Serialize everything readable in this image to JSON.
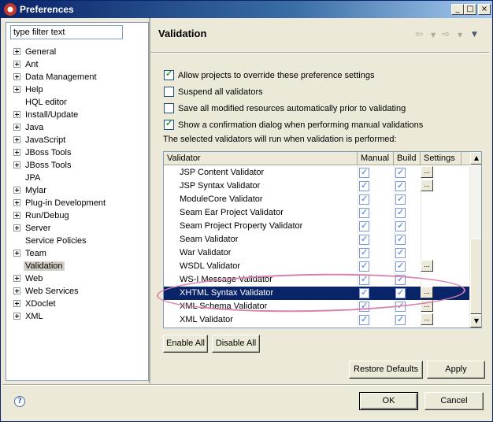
{
  "window": {
    "title": "Preferences"
  },
  "filter": {
    "value": "type filter text"
  },
  "tree": [
    {
      "label": "General",
      "expandable": true
    },
    {
      "label": "Ant",
      "expandable": true
    },
    {
      "label": "Data Management",
      "expandable": true
    },
    {
      "label": "Help",
      "expandable": true
    },
    {
      "label": "HQL editor",
      "expandable": false
    },
    {
      "label": "Install/Update",
      "expandable": true
    },
    {
      "label": "Java",
      "expandable": true
    },
    {
      "label": "JavaScript",
      "expandable": true
    },
    {
      "label": "JBoss Tools",
      "expandable": true
    },
    {
      "label": "JBoss Tools",
      "expandable": true
    },
    {
      "label": "JPA",
      "expandable": false
    },
    {
      "label": "Mylar",
      "expandable": true
    },
    {
      "label": "Plug-in Development",
      "expandable": true
    },
    {
      "label": "Run/Debug",
      "expandable": true
    },
    {
      "label": "Server",
      "expandable": true
    },
    {
      "label": "Service Policies",
      "expandable": false
    },
    {
      "label": "Team",
      "expandable": true
    },
    {
      "label": "Validation",
      "expandable": false,
      "selected": true
    },
    {
      "label": "Web",
      "expandable": true
    },
    {
      "label": "Web Services",
      "expandable": true
    },
    {
      "label": "XDoclet",
      "expandable": true
    },
    {
      "label": "XML",
      "expandable": true
    }
  ],
  "page": {
    "title": "Validation"
  },
  "options": [
    {
      "label": "Allow projects to override these preference settings",
      "checked": true
    },
    {
      "label": "Suspend all validators",
      "checked": false
    },
    {
      "label": "Save all modified resources automatically prior to validating",
      "checked": false
    },
    {
      "label": "Show a confirmation dialog when performing manual validations",
      "checked": true
    }
  ],
  "info_text": "The selected validators will run when validation is performed:",
  "table": {
    "columns": [
      "Validator",
      "Manual",
      "Build",
      "Settings"
    ],
    "rows": [
      {
        "name": "JSP Content Validator",
        "manual": true,
        "build": true,
        "settings": true
      },
      {
        "name": "JSP Syntax Validator",
        "manual": true,
        "build": true,
        "settings": true
      },
      {
        "name": "ModuleCore Validator",
        "manual": true,
        "build": true,
        "settings": false
      },
      {
        "name": "Seam Ear Project Validator",
        "manual": true,
        "build": true,
        "settings": false
      },
      {
        "name": "Seam Project Property Validator",
        "manual": true,
        "build": true,
        "settings": false
      },
      {
        "name": "Seam Validator",
        "manual": true,
        "build": true,
        "settings": false
      },
      {
        "name": "War Validator",
        "manual": true,
        "build": true,
        "settings": false
      },
      {
        "name": "WSDL Validator",
        "manual": true,
        "build": true,
        "settings": true
      },
      {
        "name": "WS-I Message Validator",
        "manual": true,
        "build": true,
        "settings": false
      },
      {
        "name": "XHTML Syntax Validator",
        "manual": true,
        "build": true,
        "settings": true,
        "selected": true
      },
      {
        "name": "XML Schema Validator",
        "manual": true,
        "build": true,
        "settings": true
      },
      {
        "name": "XML Validator",
        "manual": true,
        "build": true,
        "settings": true
      }
    ]
  },
  "buttons": {
    "enable_all": "Enable All",
    "disable_all": "Disable All",
    "restore_defaults": "Restore Defaults",
    "apply": "Apply",
    "ok": "OK",
    "cancel": "Cancel"
  },
  "colors": {
    "selection": "#0a246a",
    "annotation_oval": "#d982ad"
  }
}
